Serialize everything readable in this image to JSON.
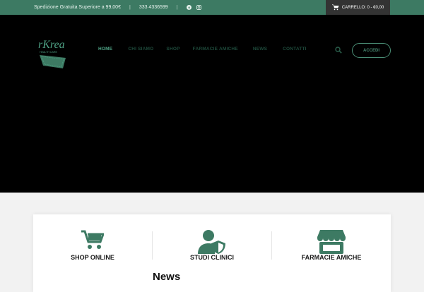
{
  "topbar": {
    "shipping": "Spedizione Gratuita Superiore a 99,00€",
    "sep": "|",
    "phone": "333 4336599",
    "social": [
      "facebook-icon",
      "instagram-icon"
    ]
  },
  "cart": {
    "label": "CARRELLO: 0 - €0,00",
    "icon": "cart-icon"
  },
  "header": {
    "nav": [
      "HOME",
      "CHI SIAMO",
      "SHOP",
      "FARMACIE AMICHE",
      "NEWS",
      "CONTATTI"
    ],
    "active": "HOME",
    "login_label": "ACCEDI"
  },
  "features": [
    {
      "label": "SHOP ONLINE",
      "icon": "shopping-cart-icon"
    },
    {
      "label": "STUDI CLINICI",
      "icon": "user-shield-icon"
    },
    {
      "label": "FARMACIE AMICHE",
      "icon": "store-icon"
    }
  ],
  "news": {
    "title": "News"
  },
  "colors": {
    "brand": "#3d7a63",
    "accent": "#4fa386",
    "dark": "#000000"
  }
}
